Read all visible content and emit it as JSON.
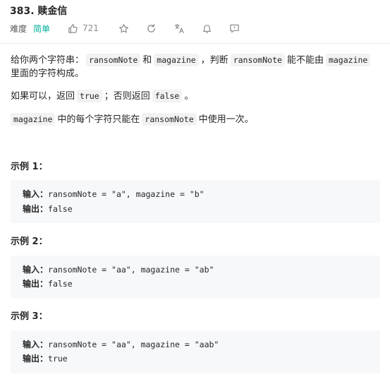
{
  "problem": {
    "title": "383. 赎金信",
    "difficulty_label": "难度",
    "difficulty": "简单",
    "likes": "721"
  },
  "icons": {
    "like": "thumbs-up-icon",
    "favorite": "star-icon",
    "refresh": "refresh-icon",
    "translate": "translate-icon",
    "notify": "bell-icon",
    "comment": "comment-icon"
  },
  "colors": {
    "easy": "#00af9b",
    "code_bg": "#f2f2f2",
    "example_bg": "#f7f8fa"
  },
  "description": {
    "p1": {
      "t1": "给你两个字符串：",
      "c1": "ransomNote",
      "t2": "和",
      "c2": "magazine",
      "t3": "，判断",
      "c3": "ransomNote",
      "t4": "能不能由",
      "c4": "magazine",
      "t5": "里面的字符构成。"
    },
    "p2": {
      "t1": "如果可以，返回",
      "c1": "true",
      "t2": "；否则返回",
      "c2": "false",
      "t3": "。"
    },
    "p3": {
      "c1": "magazine",
      "t1": "中的每个字符只能在",
      "c2": "ransomNote",
      "t2": "中使用一次。"
    }
  },
  "examples": [
    {
      "title": "示例 1：",
      "input_label": "输入：",
      "input": "ransomNote = \"a\", magazine = \"b\"",
      "output_label": "输出：",
      "output": "false"
    },
    {
      "title": "示例 2：",
      "input_label": "输入：",
      "input": "ransomNote = \"aa\", magazine = \"ab\"",
      "output_label": "输出：",
      "output": "false"
    },
    {
      "title": "示例 3：",
      "input_label": "输入：",
      "input": "ransomNote = \"aa\", magazine = \"aab\"",
      "output_label": "输出：",
      "output": "true"
    }
  ]
}
